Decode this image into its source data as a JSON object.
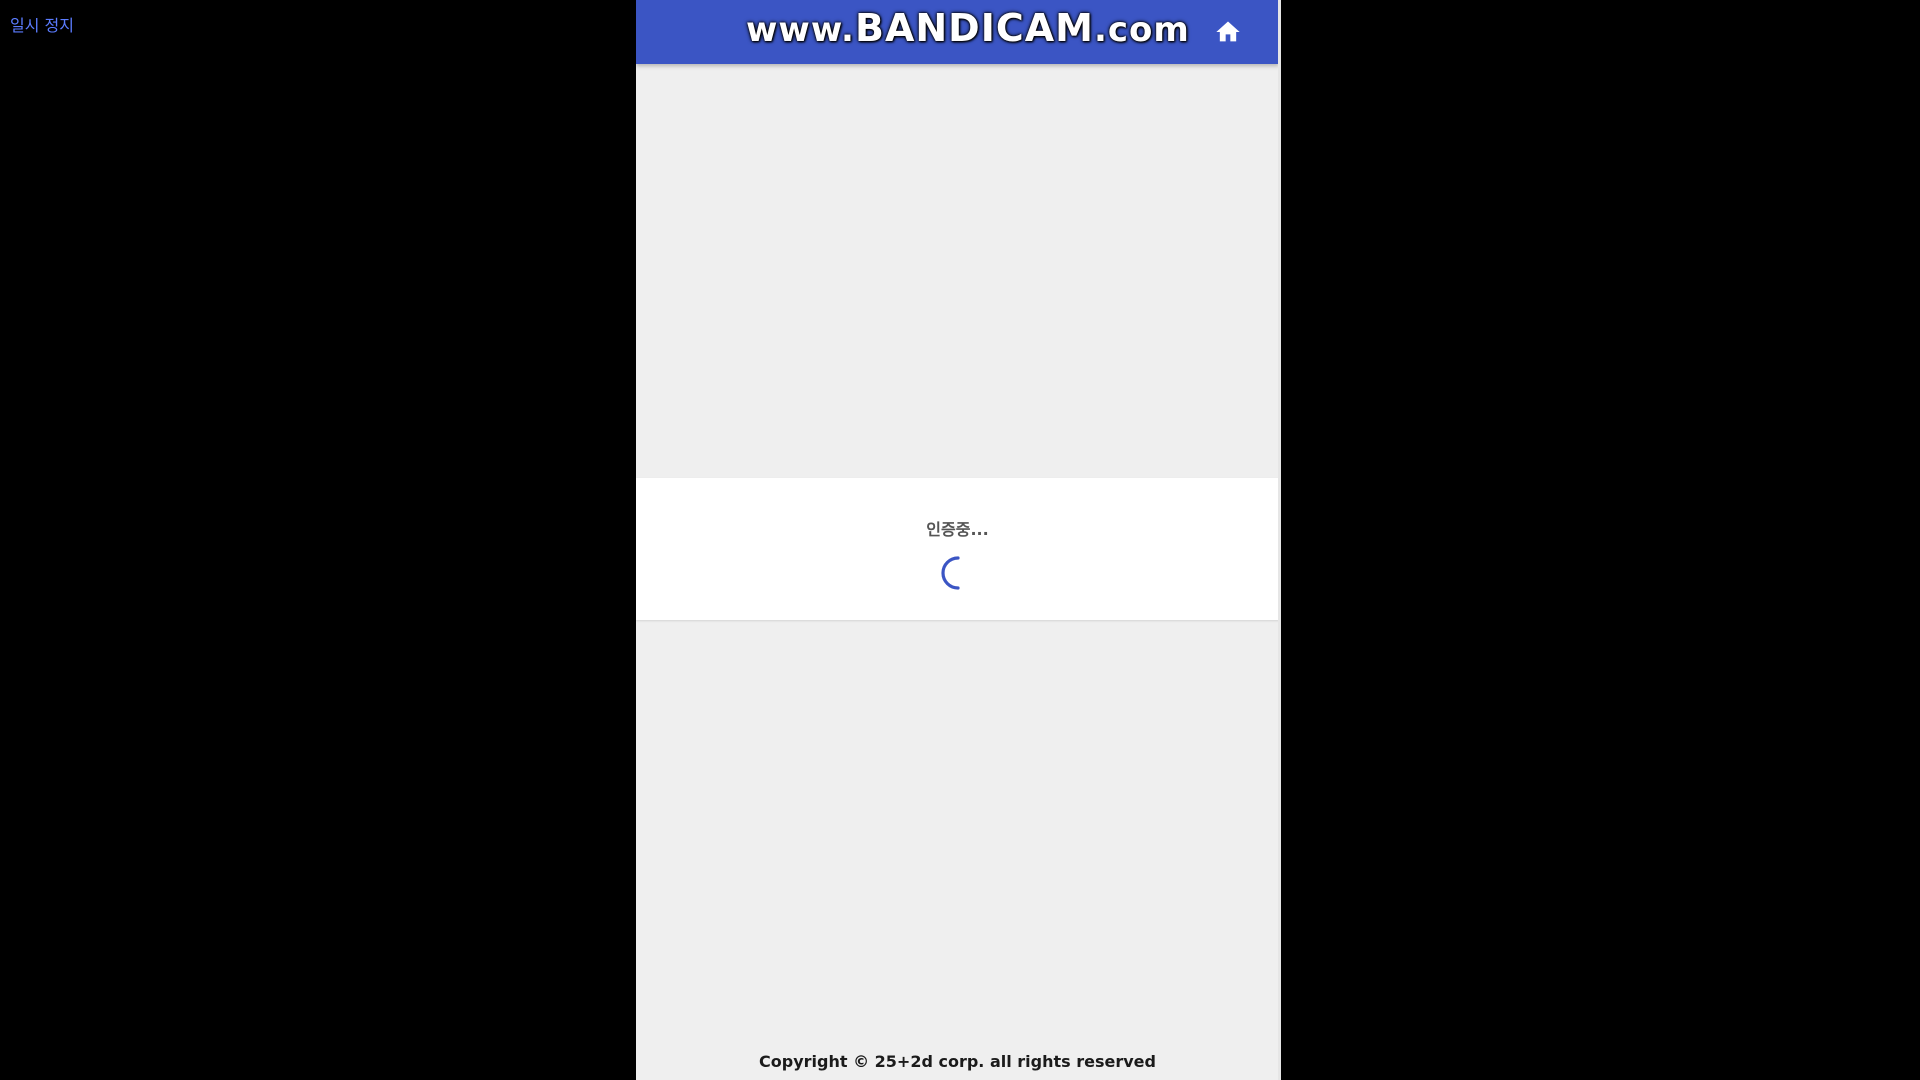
{
  "overlay": {
    "pause_label": "일시 정지"
  },
  "recorder_watermark": {
    "prefix": "www.",
    "brand": "BANDICAM",
    "suffix": ".com"
  },
  "header": {
    "home_icon": "home-icon",
    "accent_color": "#3b55c4"
  },
  "auth": {
    "status_text": "인증중...",
    "spinner_icon": "loading-spinner-icon"
  },
  "footer": {
    "copyright": "Copyright © 25+2d corp. all rights reserved"
  }
}
